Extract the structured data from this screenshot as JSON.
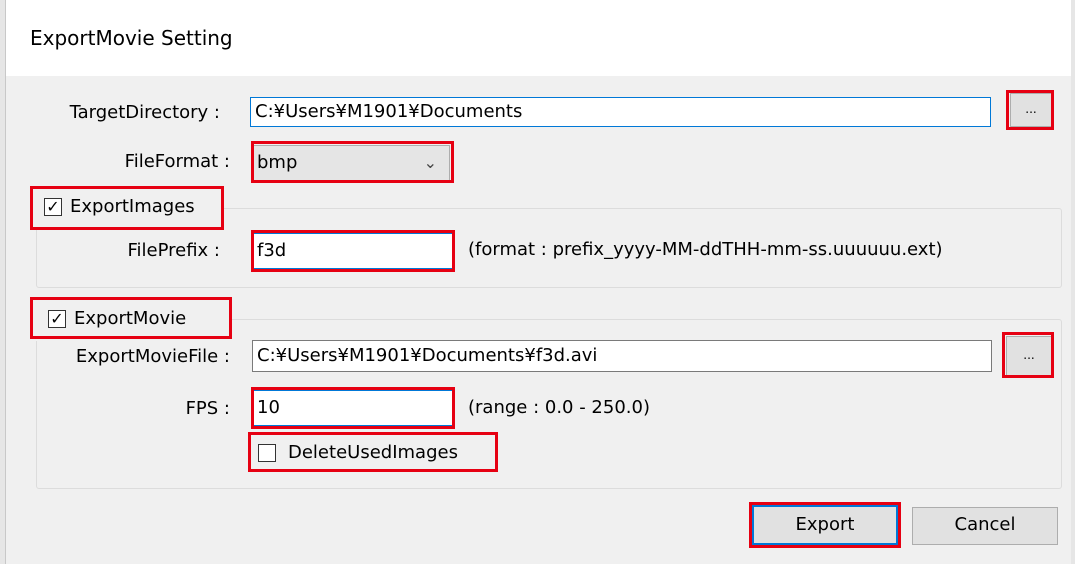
{
  "window": {
    "title": "ExportMovie Setting"
  },
  "target_directory": {
    "label": "TargetDirectory :",
    "value": "C:¥Users¥M1901¥Documents",
    "browse_label": "..."
  },
  "file_format": {
    "label": "FileFormat :",
    "selected": "bmp"
  },
  "export_images": {
    "label": "ExportImages",
    "checked": true,
    "file_prefix": {
      "label": "FilePrefix :",
      "value": "f3d",
      "hint": "(format : prefix_yyyy-MM-ddTHH-mm-ss.uuuuuu.ext)"
    }
  },
  "export_movie": {
    "label": "ExportMovie",
    "checked": true,
    "movie_file": {
      "label": "ExportMovieFile :",
      "value": "C:¥Users¥M1901¥Documents¥f3d.avi",
      "browse_label": "..."
    },
    "fps": {
      "label": "FPS :",
      "value": "10",
      "hint": "(range : 0.0 - 250.0)"
    },
    "delete_used_images": {
      "label": "DeleteUsedImages",
      "checked": false
    }
  },
  "buttons": {
    "export": "Export",
    "cancel": "Cancel"
  },
  "colors": {
    "highlight": "#e60012",
    "focus": "#0078d7",
    "dialog_bg": "#f0f0f0"
  }
}
